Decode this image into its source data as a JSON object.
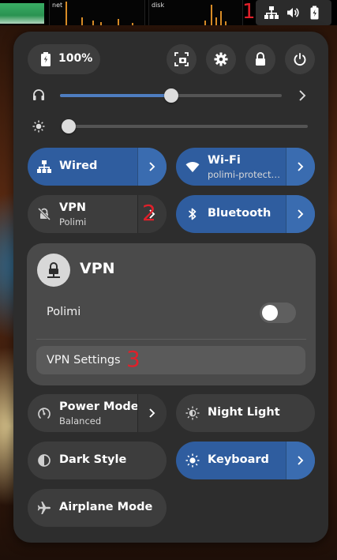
{
  "topbar": {
    "net_label": "net",
    "disk_label": "disk",
    "marker": "1",
    "tray_icons": [
      "network-wired-icon",
      "volume-icon",
      "battery-icon"
    ]
  },
  "header": {
    "battery_percent": "100%",
    "buttons": [
      "screenshot-icon",
      "settings-icon",
      "lock-icon",
      "power-icon"
    ]
  },
  "volume": {
    "level": 0.5,
    "icon": "headphones-icon"
  },
  "brightness": {
    "level": 0.0,
    "icon": "brightness-icon"
  },
  "tiles": {
    "wired": {
      "title": "Wired",
      "active": true
    },
    "wifi": {
      "title": "Wi-Fi",
      "subtitle": "polimi-protect…",
      "active": true
    },
    "vpn": {
      "title": "VPN",
      "subtitle": "Polimi",
      "active": false,
      "marker": "2"
    },
    "bluetooth": {
      "title": "Bluetooth",
      "active": true
    },
    "power_mode": {
      "title": "Power Mode",
      "subtitle": "Balanced",
      "active": false
    },
    "night_light": {
      "title": "Night Light",
      "active": false
    },
    "dark_style": {
      "title": "Dark Style",
      "active": false
    },
    "keyboard": {
      "title": "Keyboard",
      "active": true
    },
    "airplane": {
      "title": "Airplane Mode",
      "active": false
    }
  },
  "vpn_menu": {
    "title": "VPN",
    "connection_name": "Polimi",
    "connection_enabled": false,
    "settings_label": "VPN Settings",
    "marker": "3"
  },
  "colors": {
    "accent": "#2f5d9f",
    "panel": "#2d2d2d",
    "tile": "#3d3d3d",
    "marker": "#e0202a"
  }
}
